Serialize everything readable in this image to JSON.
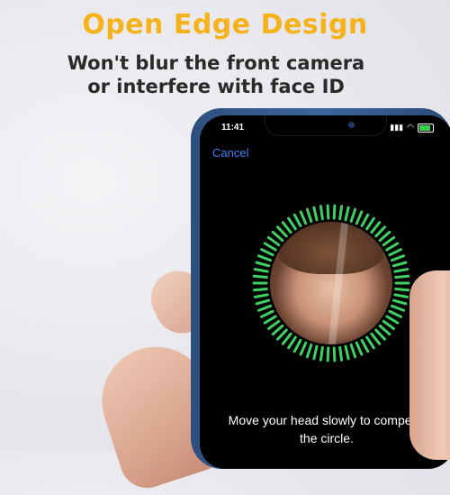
{
  "marketing": {
    "headline": "Open Edge Design",
    "subline1": "Won't blur the front camera",
    "subline2": "or interfere with face ID",
    "headline_color": "#f6b21a"
  },
  "phone": {
    "status_bar": {
      "time": "11:41",
      "icons": [
        "signal-icon",
        "wifi-icon",
        "battery-icon"
      ]
    },
    "cancel_label": "Cancel",
    "face_scan_color": "#3fcf63",
    "instruction_line1": "Move your head slowly to compelte",
    "instruction_line2": "the circle."
  }
}
